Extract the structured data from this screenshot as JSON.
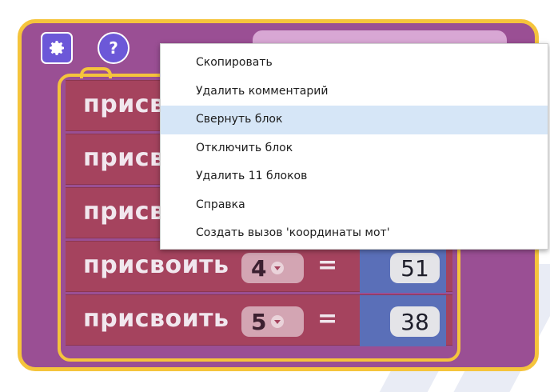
{
  "workspace": {
    "procedure": {
      "settings_icon": "gear-icon",
      "help_icon": "help-icon",
      "help_glyph": "?"
    },
    "assign_rows": [
      {
        "label": "присвоить",
        "index": "4",
        "value": "51"
      },
      {
        "label": "присвоить",
        "index": "5",
        "value": "38"
      }
    ],
    "partial_rows": [
      {
        "label": "присвоить"
      },
      {
        "label": "присвоить"
      },
      {
        "label": "присвоить"
      }
    ],
    "equals": "="
  },
  "context_menu": {
    "items": [
      {
        "label": "Скопировать"
      },
      {
        "label": "Удалить комментарий"
      },
      {
        "label": "Свернуть блок"
      },
      {
        "label": "Отключить блок"
      },
      {
        "label": "Удалить 11 блоков"
      },
      {
        "label": "Справка"
      },
      {
        "label": "Создать вызов 'координаты мот'"
      }
    ],
    "highlighted_item": "Свернуть блок"
  },
  "colors": {
    "procedure_block": "#9a4f94",
    "highlight": "#f5c43c",
    "variable_block": "#a5435e",
    "number_block": "#5a6fb8",
    "menu_hover": "#d6e6f7"
  }
}
